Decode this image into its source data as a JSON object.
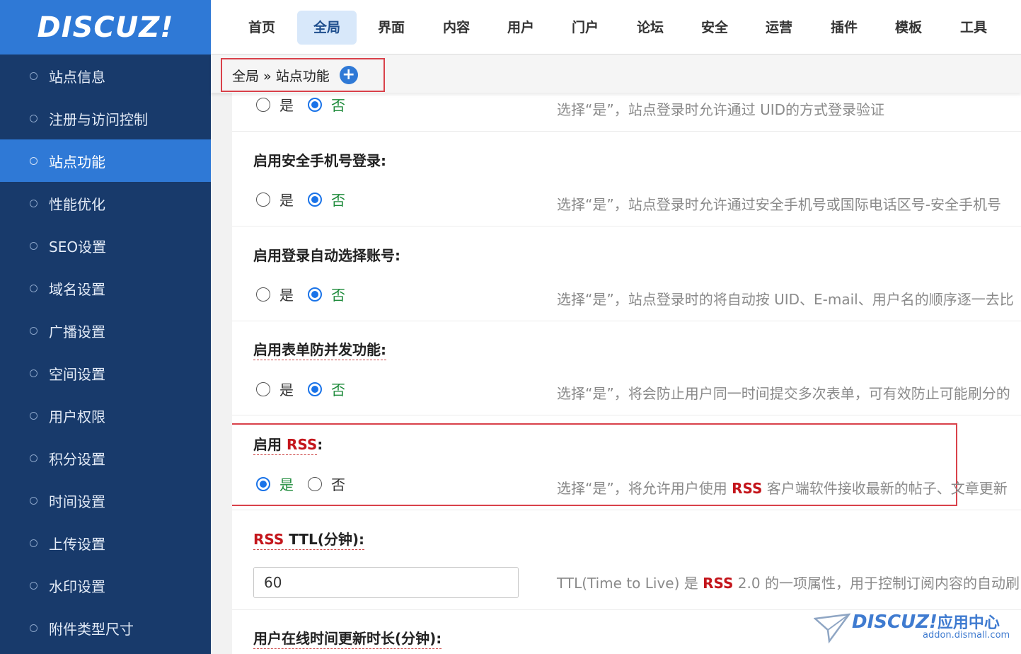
{
  "logo": "DISCUZ!",
  "sidebar": {
    "items": [
      {
        "label": "站点信息"
      },
      {
        "label": "注册与访问控制"
      },
      {
        "label": "站点功能"
      },
      {
        "label": "性能优化"
      },
      {
        "label": "SEO设置"
      },
      {
        "label": "域名设置"
      },
      {
        "label": "广播设置"
      },
      {
        "label": "空间设置"
      },
      {
        "label": "用户权限"
      },
      {
        "label": "积分设置"
      },
      {
        "label": "时间设置"
      },
      {
        "label": "上传设置"
      },
      {
        "label": "水印设置"
      },
      {
        "label": "附件类型尺寸"
      }
    ],
    "active": "站点功能"
  },
  "topnav": {
    "items": [
      "首页",
      "全局",
      "界面",
      "内容",
      "用户",
      "门户",
      "论坛",
      "安全",
      "运营",
      "插件",
      "模板",
      "工具"
    ],
    "active": "全局"
  },
  "breadcrumb": {
    "text": "全局 » 站点功能",
    "plus": "+"
  },
  "radio": {
    "yes": "是",
    "no": "否"
  },
  "settings": {
    "uid_login": {
      "value": "否",
      "desc": "选择“是”，站点登录时允许通过 UID的方式登录验证"
    },
    "secmobile_login": {
      "title": "启用安全手机号登录:",
      "value": "否",
      "desc": "选择“是”，站点登录时允许通过安全手机号或国际电话区号-安全手机号"
    },
    "auto_account": {
      "title": "启用登录自动选择账号:",
      "value": "否",
      "desc": "选择“是”，站点登录时的将自动按 UID、E-mail、用户名的顺序逐一去比"
    },
    "form_concurrency": {
      "title": "启用表单防并发功能:",
      "value": "否",
      "desc": "选择“是”，将会防止用户同一时间提交多次表单，可有效防止可能刷分的"
    },
    "rss": {
      "title_prefix": "启用 ",
      "title_red": "RSS",
      "title_suffix": ":",
      "value": "是",
      "desc_prefix": "选择“是”，将允许用户使用 ",
      "desc_red": "RSS",
      "desc_suffix": " 客户端软件接收最新的帖子、文章更新"
    },
    "rss_ttl": {
      "title_red": "RSS",
      "title_suffix": " TTL(分钟):",
      "input_value": "60",
      "desc_prefix": "TTL(Time to Live) 是 ",
      "desc_red": "RSS",
      "desc_suffix": " 2.0 的一项属性，用于控制订阅内容的自动刷"
    },
    "online_time": {
      "title": "用户在线时间更新时长(分钟):"
    }
  },
  "watermark": {
    "brand": "DISCUZ!",
    "cn": "应用中心",
    "url": "addon.dismall.com"
  },
  "colors": {
    "sidebar_bg": "#183a6b",
    "sidebar_active": "#2f79d6",
    "highlight_border": "#d9414a",
    "accent_red": "#c4161c",
    "radio_checked": "#1a73e8"
  }
}
